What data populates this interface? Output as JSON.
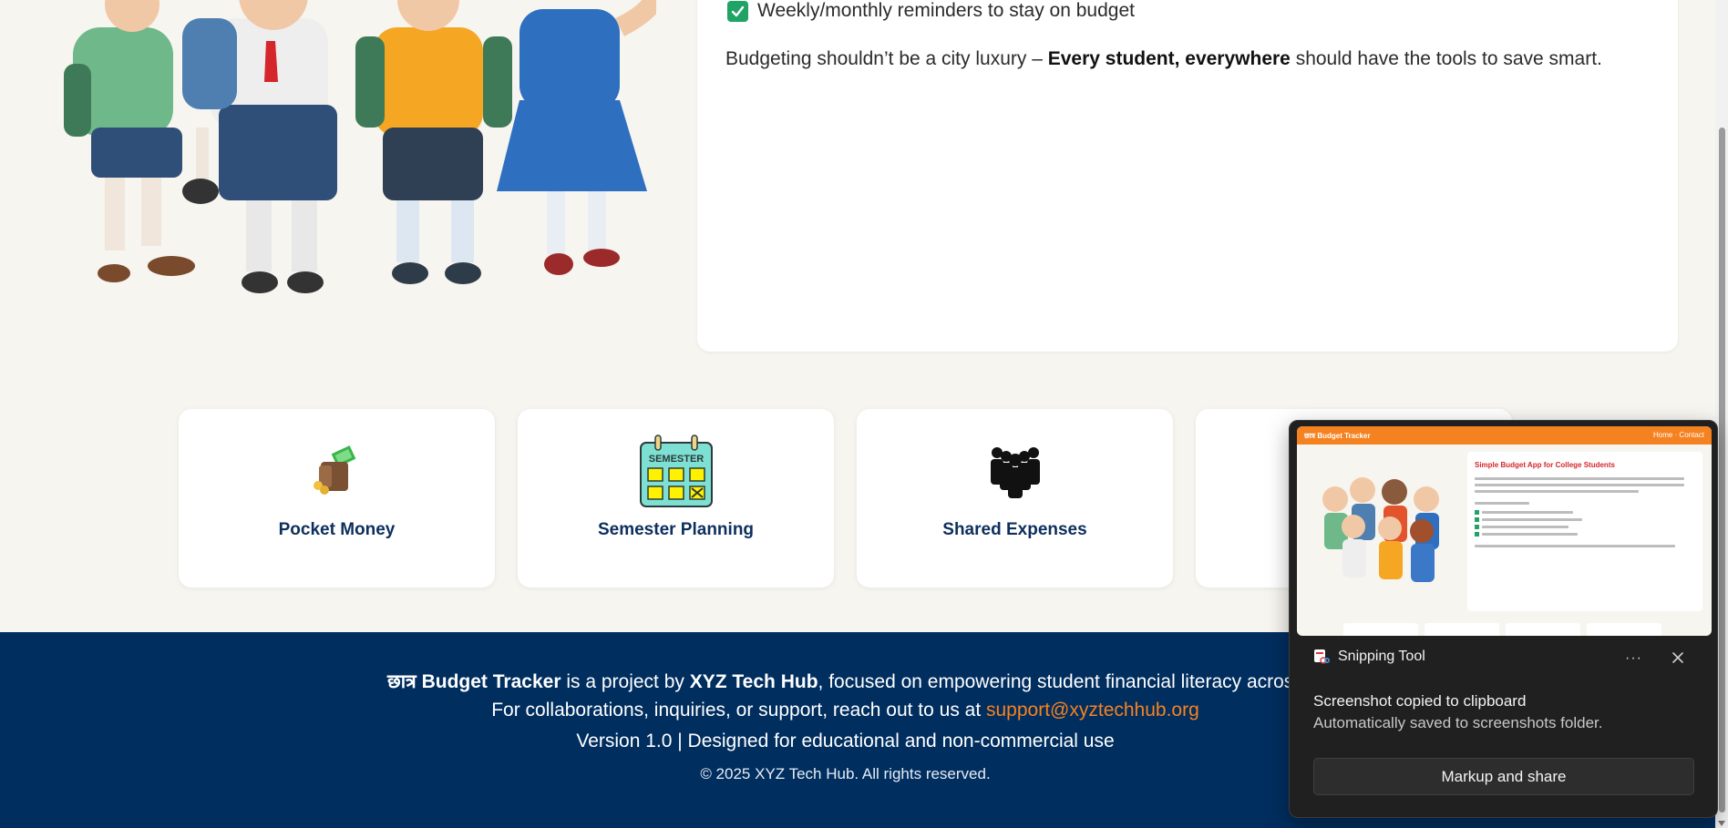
{
  "info_card": {
    "checklist_item": "Weekly/monthly reminders to stay on budget",
    "tagline_pre": "Budgeting shouldn’t be a city luxury – ",
    "tagline_bold": "Every student, everywhere",
    "tagline_post": " should have the tools to save smart."
  },
  "features": [
    {
      "label": "Pocket Money",
      "icon": "wallet-money-icon"
    },
    {
      "label": "Semester Planning",
      "icon": "semester-calendar-icon"
    },
    {
      "label": "Shared Expenses",
      "icon": "group-people-icon"
    }
  ],
  "footer": {
    "brand_hindi": "छात्र",
    "brand_name": " Budget Tracker",
    "l1_a": " is a project by ",
    "org": "XYZ Tech Hub",
    "l1_b": ", focused on empowering student financial literacy across India.",
    "l2_a": "For collaborations, inquiries, or support, reach out to us at ",
    "email": "support@xyztechhub.org",
    "l3": "Version 1.0 | Designed for educational and non-commercial use",
    "l4": "© 2025 XYZ Tech Hub. All rights reserved."
  },
  "toast": {
    "app_name": "Snipping Tool",
    "more": "···",
    "title": "Screenshot copied to clipboard",
    "subtitle": "Automatically saved to screenshots folder.",
    "action": "Markup and share",
    "preview": {
      "bar_title": "छात्र Budget Tracker",
      "bar_nav": "Home · Contact",
      "card_title": "Simple Budget App for College Students"
    }
  },
  "colors": {
    "footer_bg": "#002e5f",
    "accent_orange": "#f58220",
    "check_green": "#21a366",
    "feature_label": "#0d2f5c"
  }
}
